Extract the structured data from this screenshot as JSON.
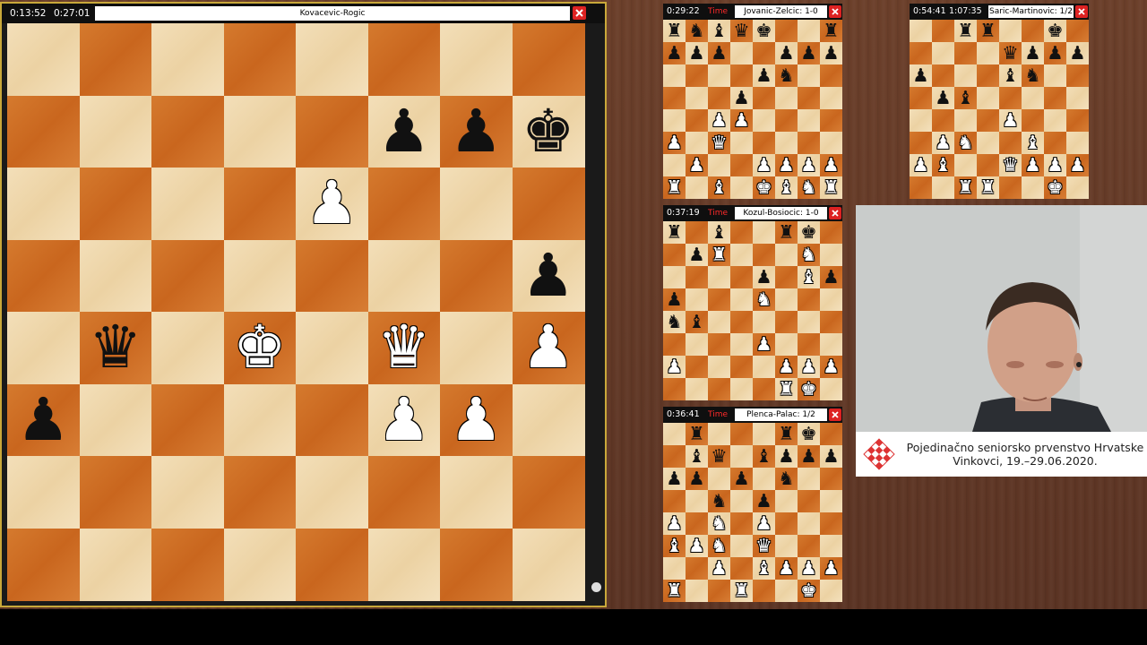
{
  "main": {
    "clock_white": "0:13:52",
    "clock_black": "0:27:01",
    "title": "Kovacevic-Rogic",
    "position": [
      "........",
      ".....ppk",
      "....P...",
      ".......p",
      ".q.K.Q.P",
      "p....PP.",
      "........",
      "........"
    ]
  },
  "mini_boards": [
    {
      "id": "board-1",
      "clock": "0:29:22",
      "time_label": "Time",
      "title": "Jovanic-Zelcic: 1-0",
      "position": [
        "rnbqk..r",
        "ppp..ppp",
        "....pn..",
        "...p....",
        "..PP....",
        "P.Q.....",
        ".P..PPPP",
        "R.B.KBNR"
      ]
    },
    {
      "id": "board-2",
      "clock": "0:54:41",
      "time_label": "",
      "clock2": "1:07:35",
      "title": "Saric-Martinovic: 1/2",
      "position": [
        "..rr..k.",
        "....qppp",
        "p...bn..",
        ".pb.....",
        "....P...",
        ".PN..B..",
        "PB..QPPP",
        "..RR..K."
      ]
    },
    {
      "id": "board-3",
      "clock": "0:37:19",
      "time_label": "Time",
      "title": "Kozul-Bosiocic: 1-0",
      "position": [
        "r.b..rk.",
        ".pR...N.",
        "....p.Bp",
        "p...N...",
        "nb......",
        "....P...",
        "P....PPP",
        ".....RK."
      ]
    },
    {
      "id": "board-4",
      "clock": "0:36:41",
      "time_label": "Time",
      "title": "Plenca-Palac: 1/2",
      "position": [
        ".r...rk.",
        ".bq.bppp",
        "pp.p.n..",
        "..n.p...",
        "P.N.P...",
        "BPN.Q...",
        "..P.BPPP",
        "R..R..K."
      ]
    }
  ],
  "banner": {
    "line1": "Pojedinačno seniorsko prvenstvo Hrvatske",
    "line2": "Vinkovci, 19.–29.06.2020."
  },
  "colors": {
    "light_square": "#f1dbb2",
    "dark_square": "#d0722a",
    "frame_gold": "#c9a83a",
    "close_red": "#dd2222"
  }
}
